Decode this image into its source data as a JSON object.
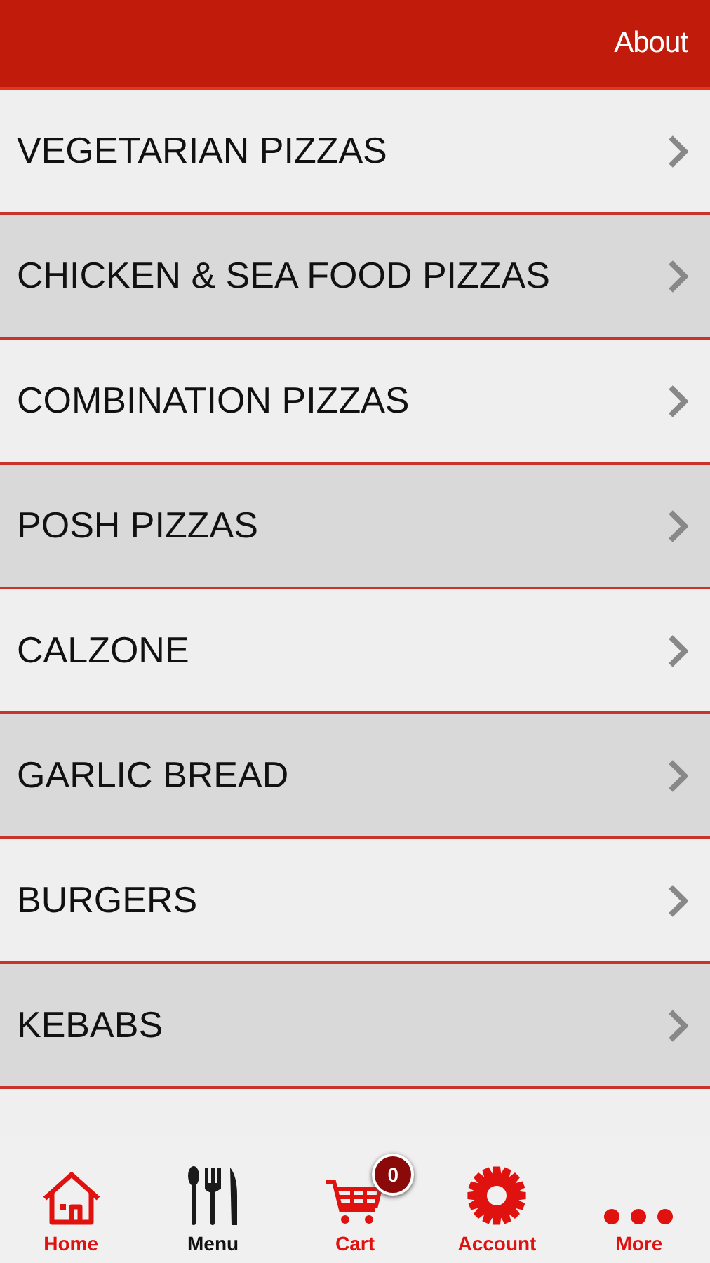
{
  "header": {
    "action": "About"
  },
  "categories": [
    {
      "label": "VEGETARIAN PIZZAS"
    },
    {
      "label": "CHICKEN & SEA FOOD PIZZAS"
    },
    {
      "label": "COMBINATION PIZZAS"
    },
    {
      "label": "POSH PIZZAS"
    },
    {
      "label": "CALZONE"
    },
    {
      "label": "GARLIC BREAD"
    },
    {
      "label": "BURGERS"
    },
    {
      "label": "KEBABS"
    }
  ],
  "tab_bar": [
    {
      "kind": "home",
      "label": "Home",
      "selected": false
    },
    {
      "kind": "menu",
      "label": "Menu",
      "selected": true
    },
    {
      "kind": "cart",
      "label": "Cart",
      "selected": false,
      "badge": "0"
    },
    {
      "kind": "account",
      "label": "Account",
      "selected": false
    },
    {
      "kind": "more",
      "label": "More",
      "selected": false
    }
  ]
}
